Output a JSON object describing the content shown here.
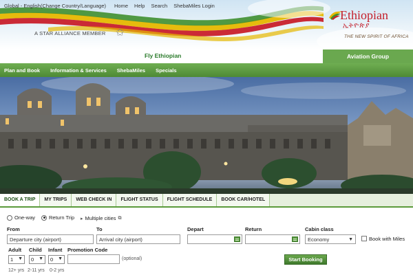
{
  "topnav": {
    "region": "Global - English(Change Country/Language)",
    "home": "Home",
    "help": "Help",
    "search": "Search",
    "login": "ShebaMiles Login"
  },
  "header": {
    "alliance_text": "A STAR ALLIANCE MEMBER",
    "logo_name": "Ethiopian",
    "logo_amharic": "ኢትዮጵያ",
    "logo_tagline": "THE NEW SPIRIT OF AFRICA",
    "fly_text": "Fly Ethiopian",
    "aviation_group": "Aviation Group"
  },
  "mainnav": {
    "items": [
      "Plan and Book",
      "Information & Services",
      "ShebaMiles",
      "Specials"
    ]
  },
  "tabs": [
    "BOOK A TRIP",
    "MY TRIPS",
    "WEB CHECK IN",
    "FLIGHT STATUS",
    "FLIGHT SCHEDULE",
    "BOOK CAR/HOTEL"
  ],
  "booking": {
    "trip_types": [
      "One-way",
      "Return Trip"
    ],
    "selected_trip": "Return Trip",
    "multi_cities": "Multiple cities",
    "from_label": "From",
    "from_value": "Departure city (airport)",
    "to_label": "To",
    "to_value": "Arrival city (airport)",
    "depart_label": "Depart",
    "return_label": "Return",
    "cabin_label": "Cabin class",
    "cabin_value": "Economy",
    "miles_label": "Book with Miles",
    "adult_label": "Adult",
    "child_label": "Child",
    "infant_label": "Infant",
    "promo_label": "Promotion Code",
    "adult_value": "1",
    "child_value": "0",
    "infant_value": "0",
    "optional_text": "(optional)",
    "start_button": "Start Booking",
    "adult_hint": "12+ yrs",
    "child_hint": "2-11 yrs",
    "infant_hint": "0-2 yrs"
  },
  "colors": {
    "brand_green": "#5a9a3a",
    "brand_red": "#c41e2a"
  }
}
